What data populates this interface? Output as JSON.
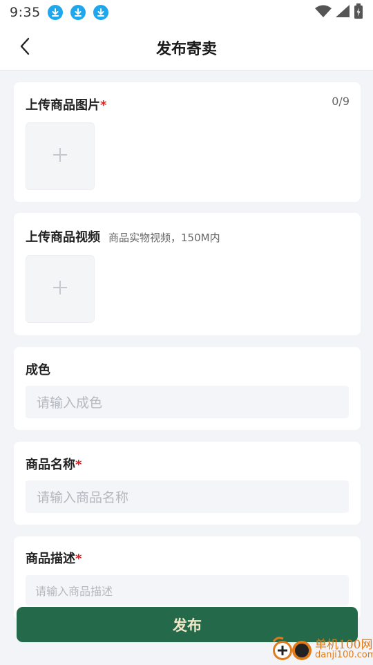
{
  "status_bar": {
    "time": "9:35",
    "icons": [
      "download-icon",
      "download-icon",
      "download-icon",
      "wifi-icon",
      "signal-icon",
      "battery-icon"
    ]
  },
  "nav": {
    "title": "发布寄卖",
    "back_icon": "chevron-left-icon"
  },
  "image_upload": {
    "label": "上传商品图片",
    "required_mark": "*",
    "counter": "0/9",
    "add_icon": "plus-icon"
  },
  "video_upload": {
    "label": "上传商品视频",
    "hint": "商品实物视频，150M内",
    "add_icon": "plus-icon"
  },
  "condition": {
    "label": "成色",
    "placeholder": "请输入成色"
  },
  "product_name": {
    "label": "商品名称",
    "required_mark": "*",
    "placeholder": "请输入商品名称"
  },
  "product_desc": {
    "label": "商品描述",
    "required_mark": "*",
    "placeholder": "请输入商品描述"
  },
  "publish": {
    "label": "发布"
  },
  "watermark": {
    "line1": "单机100网",
    "line2": "danji100.com"
  },
  "colors": {
    "accent": "#23694a",
    "button_text": "#f1e6c6",
    "required": "#e02020",
    "download_badge": "#1ea7ec",
    "background": "#f3f4f8"
  }
}
